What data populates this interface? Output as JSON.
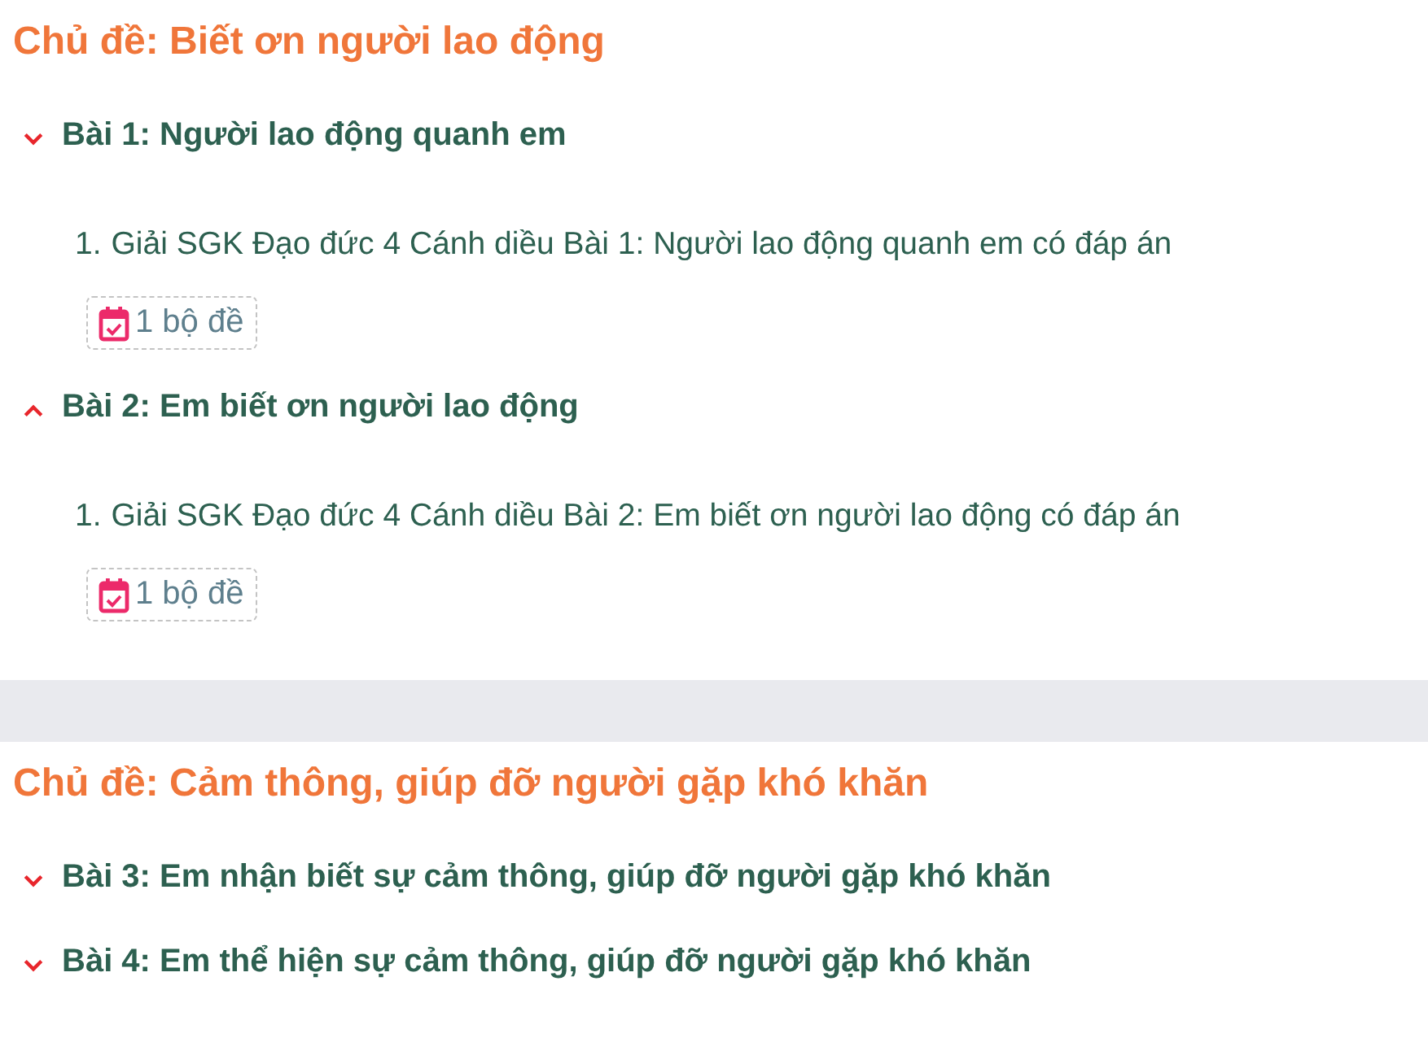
{
  "topics": [
    {
      "title": "Chủ đề: Biết ơn người lao động",
      "lessons": [
        {
          "title": "Bài 1: Người lao động quanh em",
          "expanded": false,
          "items": [
            {
              "number": "1.",
              "title": "Giải SGK Đạo đức 4 Cánh diều Bài 1: Người lao động quanh em có đáp án",
              "badge": "1 bộ đề"
            }
          ]
        },
        {
          "title": "Bài 2: Em biết ơn người lao động",
          "expanded": true,
          "items": [
            {
              "number": "1.",
              "title": "Giải SGK Đạo đức 4 Cánh diều Bài 2: Em biết ơn người lao động có đáp án",
              "badge": "1 bộ đề"
            }
          ]
        }
      ]
    },
    {
      "title": "Chủ đề: Cảm thông, giúp đỡ người gặp khó khăn",
      "lessons": [
        {
          "title": "Bài 3: Em nhận biết sự cảm thông, giúp đỡ người gặp khó khăn",
          "expanded": false
        },
        {
          "title": "Bài 4: Em thể hiện sự cảm thông, giúp đỡ người gặp khó khăn",
          "expanded": false
        }
      ]
    }
  ]
}
